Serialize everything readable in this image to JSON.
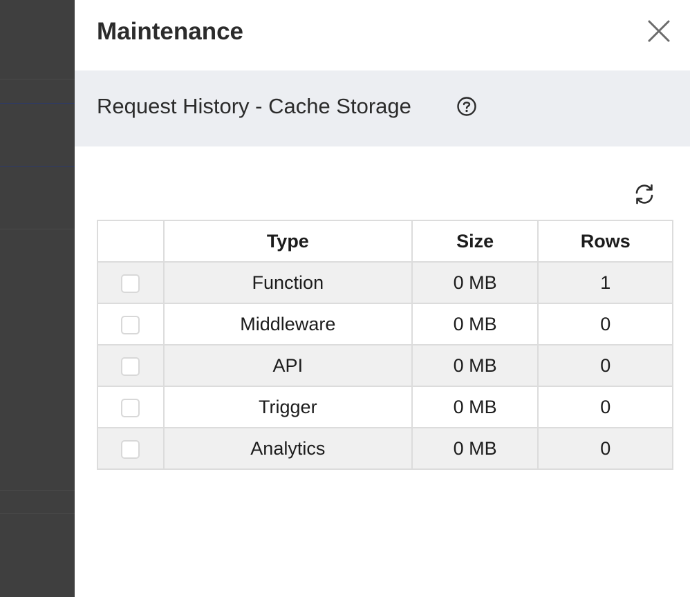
{
  "drawer": {
    "title": "Maintenance",
    "close_icon": "close-icon"
  },
  "section": {
    "title": "Request History - Cache Storage",
    "help_icon": "help-circle-icon"
  },
  "toolbar": {
    "refresh_icon": "refresh-icon"
  },
  "table": {
    "columns": [
      "",
      "Type",
      "Size",
      "Rows"
    ],
    "rows": [
      {
        "checked": false,
        "type": "Function",
        "size": "0 MB",
        "rows": "1"
      },
      {
        "checked": false,
        "type": "Middleware",
        "size": "0 MB",
        "rows": "0"
      },
      {
        "checked": false,
        "type": "API",
        "size": "0 MB",
        "rows": "0"
      },
      {
        "checked": false,
        "type": "Trigger",
        "size": "0 MB",
        "rows": "0"
      },
      {
        "checked": false,
        "type": "Analytics",
        "size": "0 MB",
        "rows": "0"
      }
    ]
  },
  "colors": {
    "section_bg": "#eceef2",
    "row_alt_bg": "#f0f0f0",
    "border": "#dcdcdc",
    "backdrop": "#3f3f3f"
  }
}
